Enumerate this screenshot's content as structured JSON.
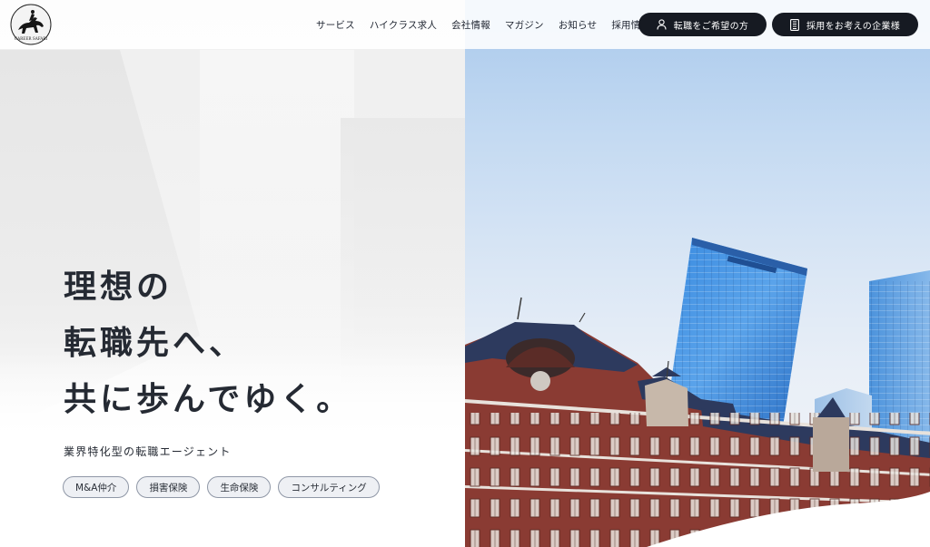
{
  "header": {
    "logo_text": "CAREER SAFARI",
    "nav": [
      {
        "label": "サービス"
      },
      {
        "label": "ハイクラス求人"
      },
      {
        "label": "会社情報"
      },
      {
        "label": "マガジン"
      },
      {
        "label": "お知らせ"
      },
      {
        "label": "採用情報"
      }
    ],
    "cta_job_seeker": {
      "label": "転職をご希望の方",
      "icon": "person-icon"
    },
    "cta_company": {
      "label": "採用をお考えの企業様",
      "icon": "building-icon"
    }
  },
  "hero": {
    "headline_lines": [
      "理想の",
      "転職先へ、",
      "共に歩んでゆく。"
    ],
    "subcopy": "業界特化型の転職エージェント",
    "tags": [
      "M&A仲介",
      "損害保険",
      "生命保険",
      "コンサルティング"
    ]
  },
  "colors": {
    "dark": "#161a22",
    "text": "#252a33",
    "sky": "#c4daf2",
    "brick": "#8a3b33",
    "glass": "#2f7fd6"
  }
}
